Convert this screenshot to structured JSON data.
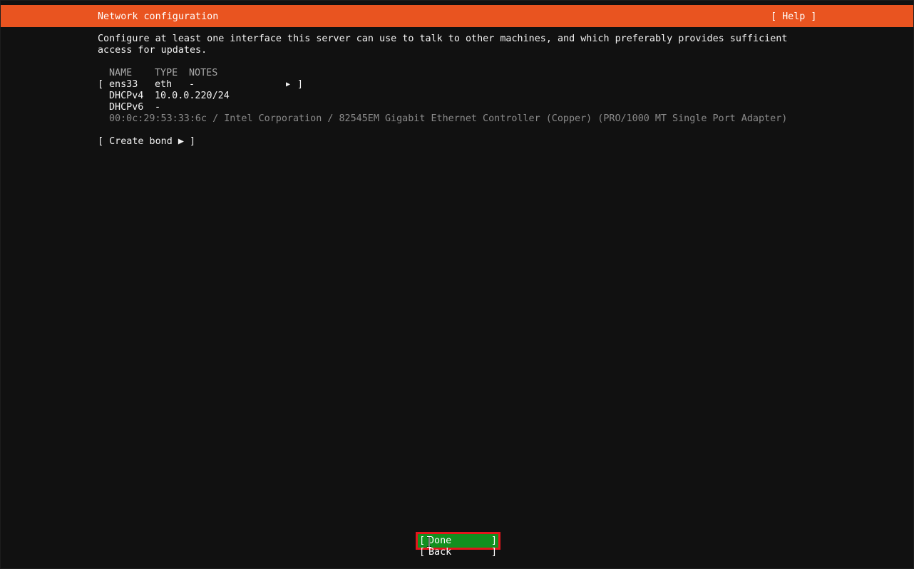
{
  "header": {
    "title": "Network configuration",
    "help_label": "[ Help ]",
    "color": "#e95420"
  },
  "intro": {
    "line1": "Configure at least one interface this server can use to talk to other machines, and which preferably provides sufficient",
    "line2": "access for updates."
  },
  "table": {
    "headers": {
      "name": "NAME",
      "type": "TYPE",
      "notes": "NOTES"
    },
    "interface": {
      "open_bracket": "[",
      "name": "ens33",
      "type": "eth",
      "notes": "-",
      "arrow": "▶",
      "close_bracket": "]",
      "dhcpv4_label": "DHCPv4",
      "dhcpv4_value": "10.0.0.220/24",
      "dhcpv6_label": "DHCPv6",
      "dhcpv6_value": "-",
      "hardware": "00:0c:29:53:33:6c / Intel Corporation / 82545EM Gigabit Ethernet Controller (Copper) (PRO/1000 MT Single Port Adapter)"
    }
  },
  "create_bond": {
    "label": "[ Create bond ▶ ]"
  },
  "footer": {
    "done_open": "[",
    "done_label": "Done",
    "done_close": "]",
    "back_open": "[",
    "back_label": "Back",
    "back_close": "]",
    "done_color": "#12901f",
    "focus_outline_color": "#e3161c"
  }
}
